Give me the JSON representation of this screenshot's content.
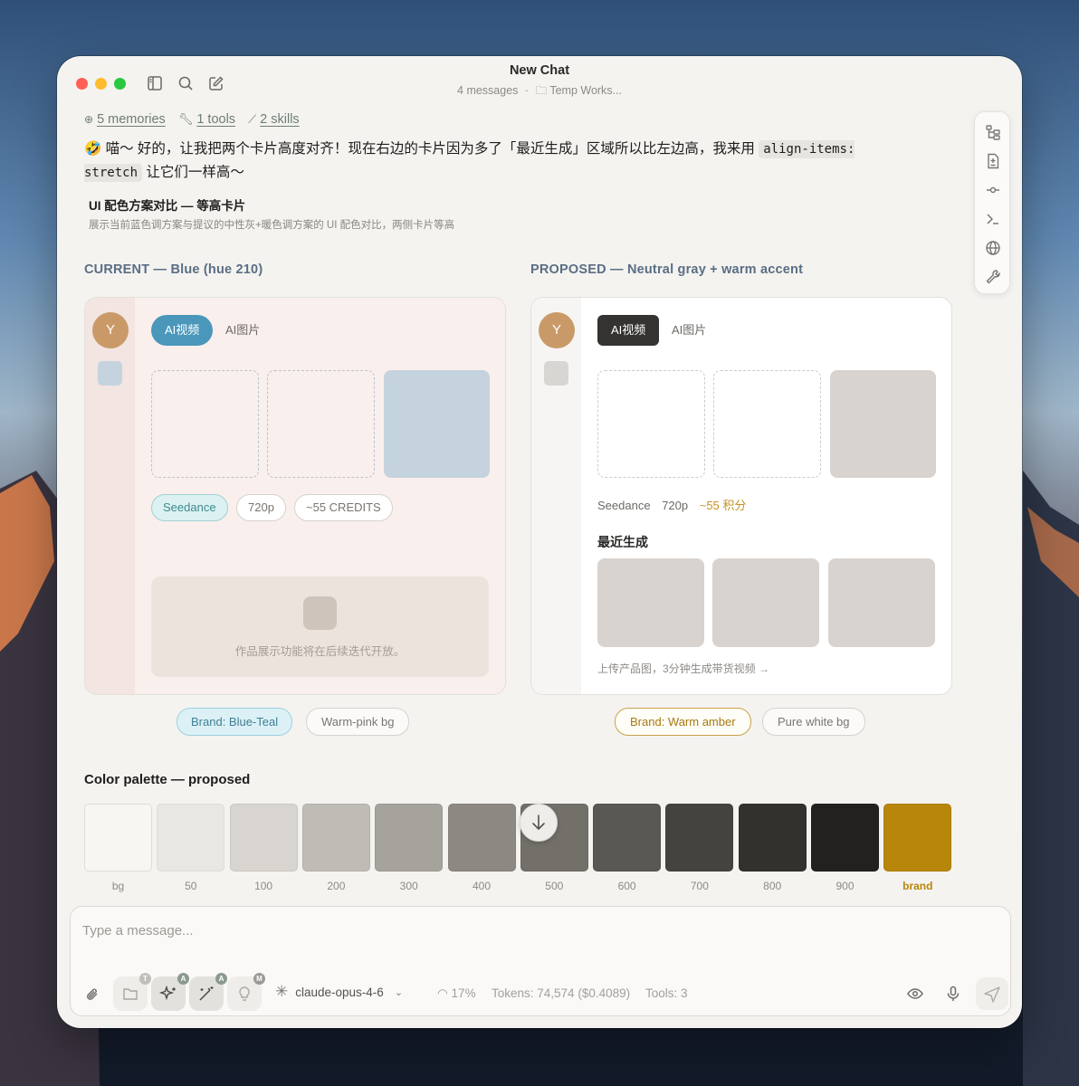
{
  "window": {
    "title": "New Chat",
    "message_count": "4 messages",
    "workspace": "Temp Works..."
  },
  "meta": {
    "memories": "5 memories",
    "tools": "1 tools",
    "skills": "2 skills"
  },
  "message": {
    "emoji": "🤣",
    "text_before": " 喵～ 好的，让我把两个卡片高度对齐！现在右边的卡片因为多了「最近生成」区域所以比左边高，我来用 ",
    "code": "align-items: stretch",
    "text_after": " 让它们一样高～"
  },
  "widget": {
    "title": "UI 配色方案对比 — 等高卡片",
    "subtitle": "展示当前蓝色调方案与提议的中性灰+暖色调方案的 UI 配色对比，两侧卡片等高"
  },
  "current": {
    "label": "CURRENT — Blue (hue 210)",
    "avatar": "Y",
    "tab_active": "AI视频",
    "tab": "AI图片",
    "pills": [
      "Seedance",
      "720p",
      "~55 CREDITS"
    ],
    "placeholder_text": "作品展示功能将在后续迭代开放。",
    "tags": [
      "Brand: Blue-Teal",
      "Warm-pink bg"
    ],
    "colors": {
      "brand": "#4a97bb",
      "bg": "#f8efec",
      "rail": "#f2e6e3",
      "slot_fill": "#c5d3de"
    }
  },
  "proposed": {
    "label": "PROPOSED — Neutral gray + warm accent",
    "avatar": "Y",
    "tab_active": "AI视频",
    "tab": "AI图片",
    "specs": {
      "model": "Seedance",
      "res": "720p",
      "cost": "~55 积分"
    },
    "recent_title": "最近生成",
    "cta": "上传产品图，3分钟生成带货视频 →",
    "tags": [
      "Brand: Warm amber",
      "Pure white bg"
    ],
    "colors": {
      "brand": "#b8860b",
      "tab_bg": "#343331",
      "bg": "#ffffff",
      "rail": "#f6f5f3"
    }
  },
  "palette": {
    "title": "Color palette — proposed",
    "swatches": [
      {
        "label": "bg",
        "color": "#f7f6f3"
      },
      {
        "label": "50",
        "color": "#e9e7e3"
      },
      {
        "label": "100",
        "color": "#d8d4cf"
      },
      {
        "label": "200",
        "color": "#bfbbb5"
      },
      {
        "label": "300",
        "color": "#a6a29c"
      },
      {
        "label": "400",
        "color": "#8d8982"
      },
      {
        "label": "500",
        "color": "#73706a"
      },
      {
        "label": "600",
        "color": "#5a5853"
      },
      {
        "label": "700",
        "color": "#44433f"
      },
      {
        "label": "800",
        "color": "#32312e"
      },
      {
        "label": "900",
        "color": "#22211f"
      },
      {
        "label": "brand",
        "color": "#b8860b"
      }
    ]
  },
  "composer": {
    "placeholder": "Type a message...",
    "model": "claude-opus-4-6",
    "context": "17%",
    "tokens": "Tokens: 74,574 ($0.4089)",
    "tools": "Tools: 3",
    "badges": [
      "T",
      "A",
      "A",
      "M"
    ]
  }
}
